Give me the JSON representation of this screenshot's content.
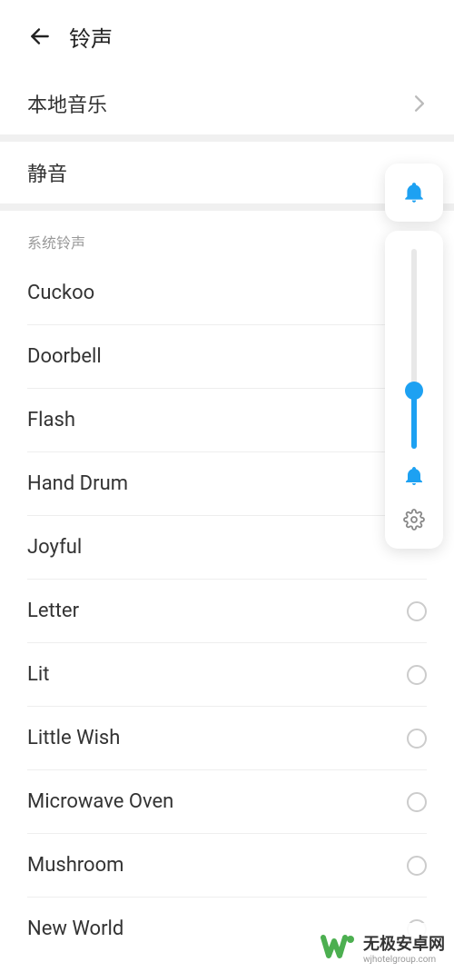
{
  "header": {
    "title": "铃声"
  },
  "local_music": {
    "label": "本地音乐"
  },
  "silent": {
    "label": "静音"
  },
  "section": {
    "title": "系统铃声"
  },
  "ringtones": [
    {
      "label": "Cuckoo",
      "show_radio": false
    },
    {
      "label": "Doorbell",
      "show_radio": false
    },
    {
      "label": "Flash",
      "show_radio": false
    },
    {
      "label": "Hand Drum",
      "show_radio": false
    },
    {
      "label": "Joyful",
      "show_radio": false
    },
    {
      "label": "Letter",
      "show_radio": true
    },
    {
      "label": "Lit",
      "show_radio": true
    },
    {
      "label": "Little Wish",
      "show_radio": true
    },
    {
      "label": "Microwave Oven",
      "show_radio": true
    },
    {
      "label": "Mushroom",
      "show_radio": true
    },
    {
      "label": "New World",
      "show_radio": true
    }
  ],
  "watermark": {
    "main": "无极安卓网",
    "sub": "wjhotelgroup.com"
  },
  "colors": {
    "accent": "#1da1f2"
  }
}
